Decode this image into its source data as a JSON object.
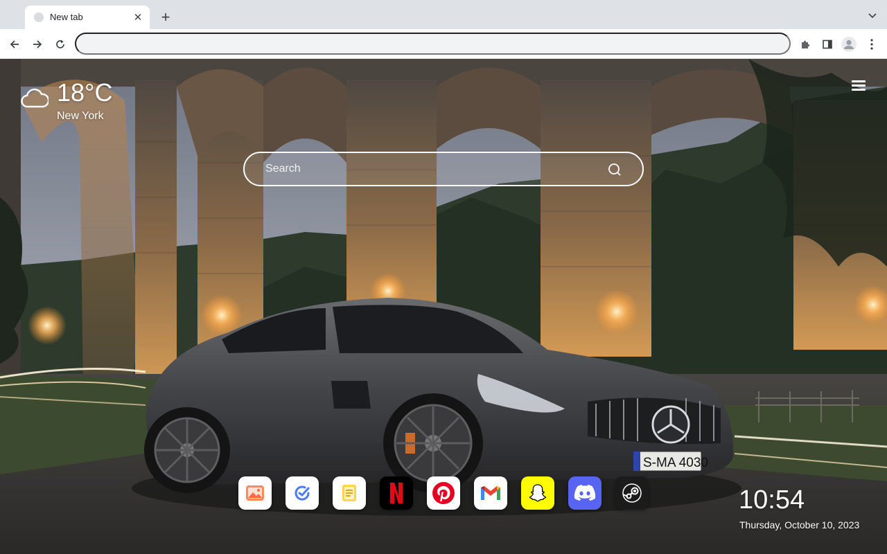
{
  "browser": {
    "tab_title": "New tab",
    "omnibox_value": ""
  },
  "weather": {
    "temperature": "18°C",
    "city": "New York",
    "icon": "cloud-icon"
  },
  "search": {
    "placeholder": "Search"
  },
  "dock": {
    "apps": [
      {
        "name": "Photos",
        "icon": "photo-icon",
        "bg": "#ffffff"
      },
      {
        "name": "Tasks",
        "icon": "check-circle-icon",
        "bg": "#ffffff"
      },
      {
        "name": "Notes",
        "icon": "notes-icon",
        "bg": "#ffffff"
      },
      {
        "name": "Netflix",
        "icon": "netflix-icon",
        "bg": "#000000"
      },
      {
        "name": "Pinterest",
        "icon": "pinterest-icon",
        "bg": "#ffffff"
      },
      {
        "name": "Gmail",
        "icon": "gmail-icon",
        "bg": "#ffffff"
      },
      {
        "name": "Snapchat",
        "icon": "snapchat-icon",
        "bg": "#fffc00"
      },
      {
        "name": "Discord",
        "icon": "discord-icon",
        "bg": "#5865f2"
      },
      {
        "name": "Steam",
        "icon": "steam-icon",
        "bg": "#1b1b1b"
      }
    ]
  },
  "clock": {
    "time": "10:54",
    "date": "Thursday, October 10, 2023"
  },
  "colors": {
    "tabstrip": "#dee1e6",
    "netflix_red": "#e50914",
    "pinterest_red": "#e60023",
    "discord_blurple": "#5865f2",
    "snapchat_yellow": "#fffc00"
  }
}
